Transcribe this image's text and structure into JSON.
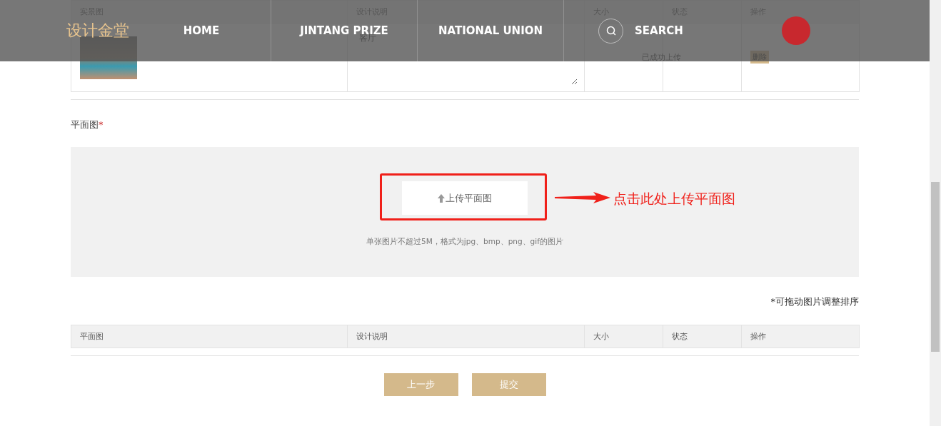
{
  "nav": {
    "logo": "设计金堂",
    "items": [
      "HOME",
      "JINTANG PRIZE",
      "NATIONAL UNION"
    ],
    "search": "SEARCH"
  },
  "photo_table": {
    "columns": [
      "实景图",
      "设计说明",
      "大小",
      "状态",
      "操作"
    ],
    "rows": [
      {
        "description": "客厅",
        "size": "",
        "status": "已成功上传",
        "action": "删除"
      }
    ]
  },
  "plan_section": {
    "label": "平面图",
    "required_mark": "*",
    "upload_button": "上传平面图",
    "hint": "单张图片不超过5M，格式为jpg、bmp、png、gif的图片",
    "annotation": "点击此处上传平面图"
  },
  "sort_note": "*可拖动图片调整排序",
  "plan_table": {
    "columns": [
      "平面图",
      "设计说明",
      "大小",
      "状态",
      "操作"
    ]
  },
  "buttons": [
    "上一步",
    "提交"
  ]
}
